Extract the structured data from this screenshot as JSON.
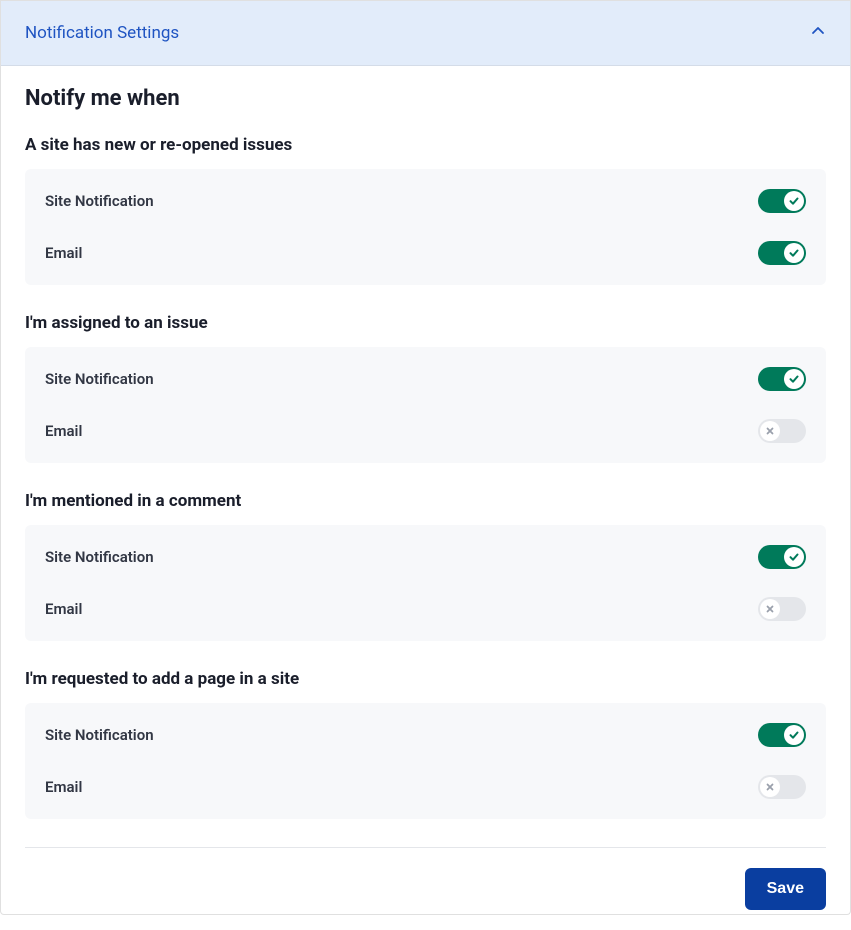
{
  "header": {
    "title": "Notification Settings"
  },
  "section_title": "Notify me when",
  "groups": [
    {
      "title": "A site has new or re-opened issues",
      "rows": [
        {
          "label": "Site Notification",
          "on": true
        },
        {
          "label": "Email",
          "on": true
        }
      ]
    },
    {
      "title": "I'm assigned to an issue",
      "rows": [
        {
          "label": "Site Notification",
          "on": true
        },
        {
          "label": "Email",
          "on": false
        }
      ]
    },
    {
      "title": "I'm mentioned in a comment",
      "rows": [
        {
          "label": "Site Notification",
          "on": true
        },
        {
          "label": "Email",
          "on": false
        }
      ]
    },
    {
      "title": "I'm requested to add a page in a site",
      "rows": [
        {
          "label": "Site Notification",
          "on": true
        },
        {
          "label": "Email",
          "on": false
        }
      ]
    }
  ],
  "footer": {
    "save_label": "Save"
  },
  "colors": {
    "header_bg": "#e2ecfa",
    "header_text": "#1f54c2",
    "toggle_on": "#007a5a",
    "toggle_off": "#e4e6ea",
    "save_bg": "#0a3ea0"
  }
}
